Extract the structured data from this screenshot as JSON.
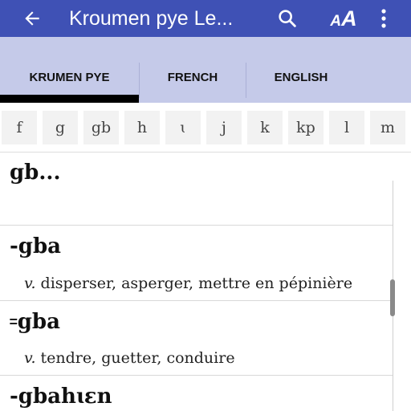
{
  "appbar": {
    "title": "Kroumen pye Le...",
    "back_icon": "arrow-left-icon",
    "search_icon": "search-icon",
    "font_size_icon": "font-size-icon",
    "more_icon": "more-vert-icon",
    "font_size_label_small": "A",
    "font_size_label_big": "A"
  },
  "tabs": [
    {
      "label": "KRUMEN PYE",
      "active": true
    },
    {
      "label": "FRENCH",
      "active": false
    },
    {
      "label": "ENGLISH",
      "active": false
    }
  ],
  "alphabet": [
    "f",
    "g",
    "gb",
    "h",
    "ɩ",
    "j",
    "k",
    "kp",
    "l",
    "m"
  ],
  "entries": {
    "section_header": "gb...",
    "items": [
      {
        "headword": "-gba",
        "pos": "v.",
        "definition": "disperser, asperger, mettre en pépinière"
      },
      {
        "headword": "꞊gba",
        "pos": "v.",
        "definition": "tendre, guetter, conduire"
      },
      {
        "headword": "-gbahɩɛn",
        "pos": "",
        "definition": ""
      }
    ]
  },
  "colors": {
    "appbar": "#3f51b5",
    "tabbar": "#c5cae9",
    "indicator": "#000000"
  }
}
